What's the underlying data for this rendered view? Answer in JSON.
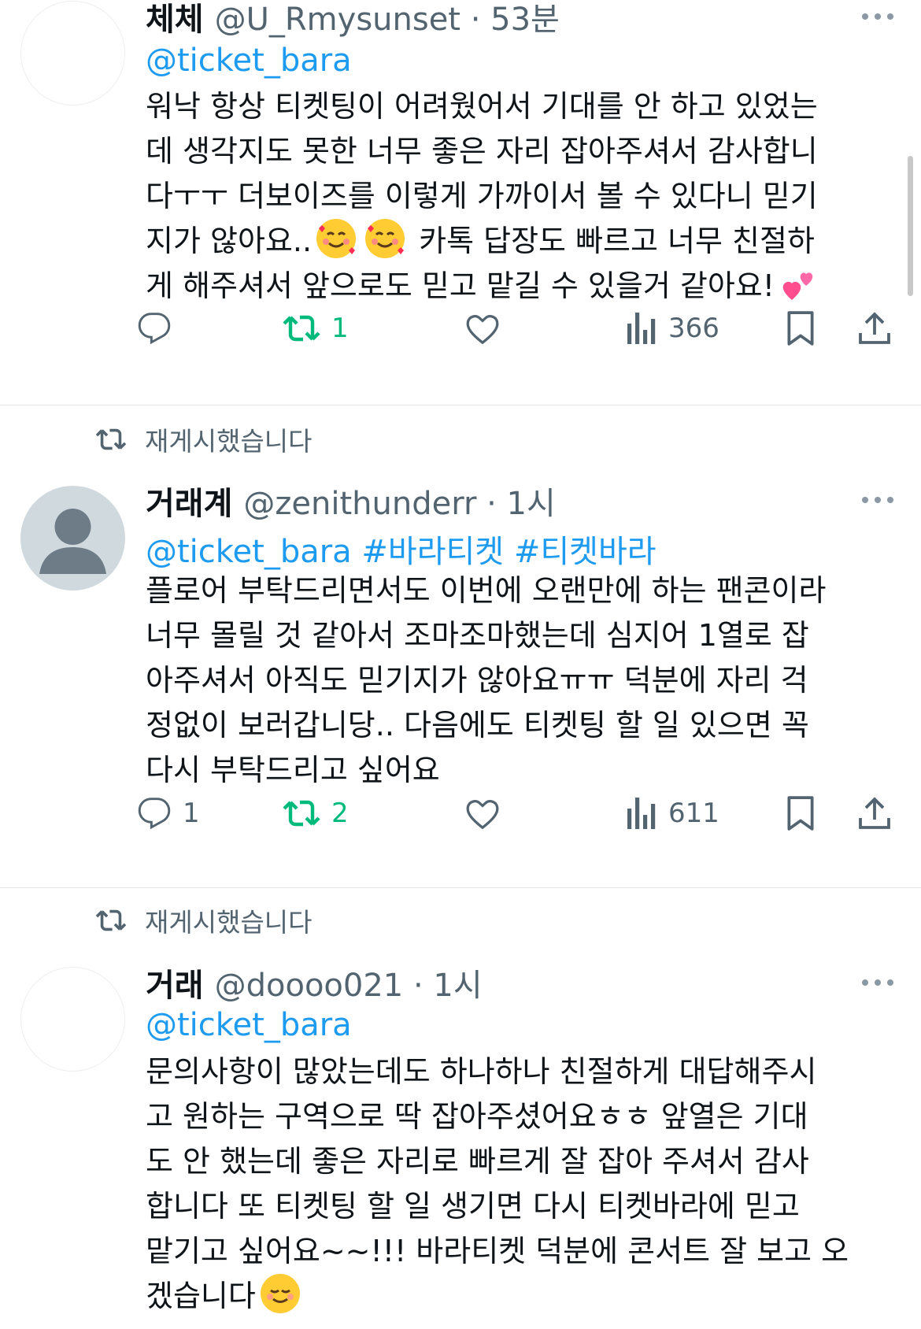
{
  "tweets": [
    {
      "retweet_label": "",
      "name": "체체",
      "handle": "@U_Rmysunset · 53분",
      "mention": "@ticket_bara",
      "lines": [
        "워낙 항상 티켓팅이 어려웠어서 기대를 안 하고 있었는",
        "데 생각지도 못한 너무 좋은 자리 잡아주셔서 감사합니",
        "다ㅜㅜ 더보이즈를 이렇게 가까이서 볼 수 있다니 믿기",
        "지가 않아요..",
        "게 해주셔서 앞으로도 믿고 맡길 수 있을거 같아요!"
      ],
      "line4_tail": "카톡 답장도 빠르고 너무 친절하",
      "replies": "",
      "retweets": "1",
      "views": "366"
    },
    {
      "retweet_label": "재게시했습니다",
      "name": "거래계",
      "handle": "@zenithunderr · 1시",
      "mention": "@ticket_bara #바라티켓 #티켓바라",
      "lines": [
        "플로어 부탁드리면서도 이번에 오랜만에 하는 팬콘이라",
        "너무 몰릴 것 같아서 조마조마했는데 심지어 1열로 잡",
        "아주셔서 아직도 믿기지가 않아요ㅠㅠ 덕분에 자리 걱",
        "정없이 보러갑니당.. 다음에도 티켓팅 할 일 있으면 꼭",
        "다시 부탁드리고 싶어요"
      ],
      "replies": "1",
      "retweets": "2",
      "views": "611"
    },
    {
      "retweet_label": "재게시했습니다",
      "name": "거래",
      "handle": "@doooo021 · 1시",
      "mention": "@ticket_bara",
      "lines": [
        "문의사항이 많았는데도 하나하나 친절하게 대답해주시",
        "고 원하는 구역으로 딱 잡아주셨어요ㅎㅎ 앞열은 기대",
        "도 안 했는데 좋은 자리로 빠르게 잘 잡아 주셔서 감사",
        "합니다 또 티켓팅 할 일 생기면 다시 티켓바라에 믿고",
        "맡기고 싶어요~~!!! 바라티켓 덕분에 콘서트 잘 보고 오",
        "겠습니다"
      ]
    }
  ],
  "colors": {
    "text": "#0f1419",
    "secondary": "#536471",
    "link": "#1d9bf0",
    "retweet_active": "#00ba7c",
    "emoji_face": "#ffcc33",
    "heart_pink": "#ff4d8d"
  },
  "icons": [
    "more-icon",
    "reply-icon",
    "retweet-icon",
    "like-icon",
    "views-icon",
    "bookmark-icon",
    "share-icon",
    "smiling-face-with-hearts-emoji",
    "two-hearts-emoji",
    "smiling-face-emoji"
  ]
}
